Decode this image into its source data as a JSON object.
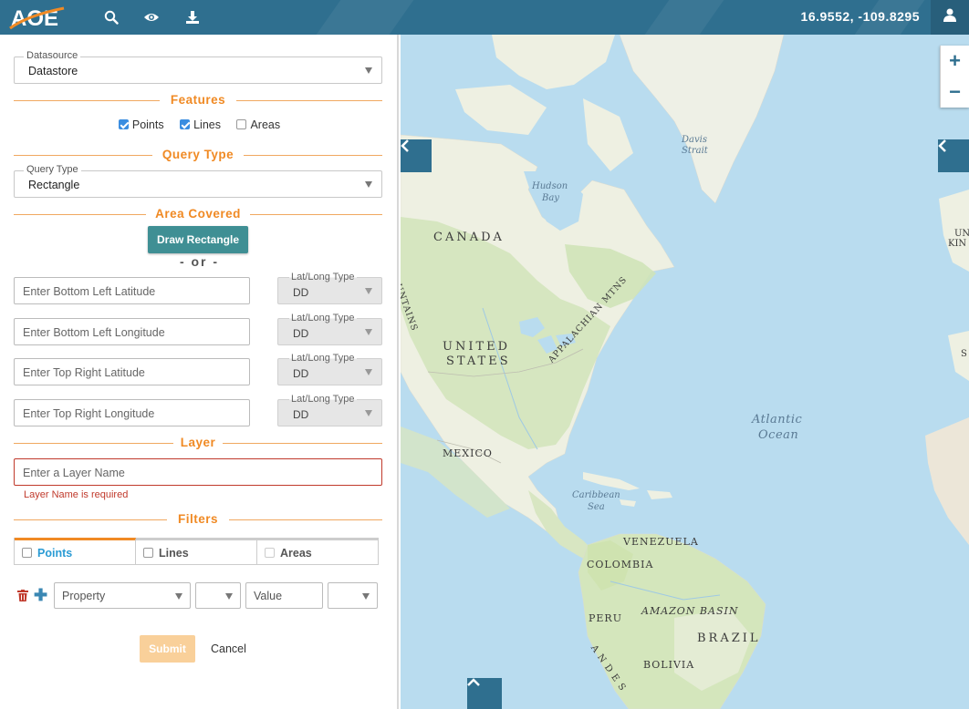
{
  "topbar": {
    "logo_text": "AOE",
    "coordinates": "16.9552, -109.8295",
    "icons": [
      "search-icon",
      "eye-icon",
      "download-icon",
      "user-icon"
    ]
  },
  "panel": {
    "datasource": {
      "legend": "Datasource",
      "value": "Datastore"
    },
    "features": {
      "title": "Features",
      "items": [
        {
          "label": "Points",
          "checked": true
        },
        {
          "label": "Lines",
          "checked": true
        },
        {
          "label": "Areas",
          "checked": false
        }
      ]
    },
    "query_type": {
      "title": "Query Type",
      "legend": "Query Type",
      "value": "Rectangle"
    },
    "area_covered": {
      "title": "Area Covered",
      "draw_button": "Draw Rectangle",
      "or_text": "- or -",
      "inputs": [
        {
          "placeholder": "Enter Bottom Left Latitude",
          "type_legend": "Lat/Long Type",
          "type_value": "DD"
        },
        {
          "placeholder": "Enter Bottom Left Longitude",
          "type_legend": "Lat/Long Type",
          "type_value": "DD"
        },
        {
          "placeholder": "Enter Top Right Latitude",
          "type_legend": "Lat/Long Type",
          "type_value": "DD"
        },
        {
          "placeholder": "Enter Top Right Longitude",
          "type_legend": "Lat/Long Type",
          "type_value": "DD"
        }
      ]
    },
    "layer": {
      "title": "Layer",
      "placeholder": "Enter a Layer Name",
      "error": "Layer Name is required"
    },
    "filters": {
      "title": "Filters",
      "tabs": [
        {
          "label": "Points",
          "active": true
        },
        {
          "label": "Lines",
          "active": false
        },
        {
          "label": "Areas",
          "active": false
        }
      ],
      "property_placeholder": "Property",
      "value_placeholder": "Value"
    },
    "submit_label": "Submit",
    "cancel_label": "Cancel"
  },
  "map": {
    "labels": {
      "canada": "CANADA",
      "united": "UNITED",
      "states": "STATES",
      "mexico": "MEXICO",
      "venezuela": "VENEZUELA",
      "colombia": "COLOMBIA",
      "peru": "PERU",
      "brazil": "BRAZIL",
      "bolivia": "BOLIVIA",
      "amazon_basin": "AMAZON BASIN",
      "appalachian": "APPALACHIAN MTNS",
      "andes": "ANDES",
      "mountains_fragment": "UNTAINS",
      "hudson1": "Hudson",
      "hudson2": "Bay",
      "davis1": "Davis",
      "davis2": "Strait",
      "caribbean1": "Caribbean",
      "caribbean2": "Sea",
      "atlantic1": "Atlantic",
      "atlantic2": "Ocean",
      "uk_fragment1": "UN",
      "uk_fragment2": "KIN",
      "s_fragment": "S"
    },
    "colors": {
      "water": "#b9dcef",
      "land": "#eef0e2",
      "forest": "#c9e0b0",
      "accent": "#2f6f8f"
    }
  }
}
